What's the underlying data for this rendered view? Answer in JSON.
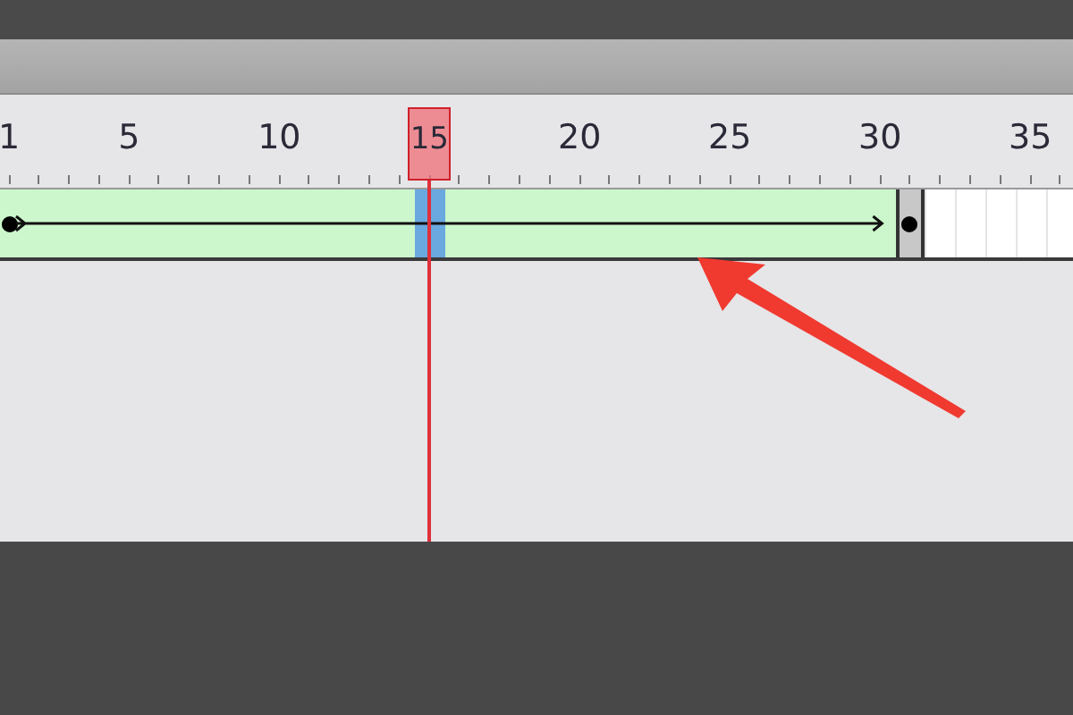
{
  "frames": [
    {
      "kind": "keyframe",
      "selected": false,
      "label": "1"
    },
    {
      "kind": "tween",
      "selected": false
    },
    {
      "kind": "tween",
      "selected": false
    },
    {
      "kind": "tween",
      "selected": false
    },
    {
      "kind": "tween",
      "selected": false,
      "label": "5"
    },
    {
      "kind": "tween",
      "selected": false
    },
    {
      "kind": "tween",
      "selected": false
    },
    {
      "kind": "tween",
      "selected": false
    },
    {
      "kind": "tween",
      "selected": false
    },
    {
      "kind": "tween",
      "selected": false,
      "label": "10"
    },
    {
      "kind": "tween",
      "selected": false
    },
    {
      "kind": "tween",
      "selected": false
    },
    {
      "kind": "tween",
      "selected": false
    },
    {
      "kind": "tween",
      "selected": false
    },
    {
      "kind": "tween",
      "selected": true,
      "label": "15"
    },
    {
      "kind": "tween",
      "selected": false
    },
    {
      "kind": "tween",
      "selected": false
    },
    {
      "kind": "tween",
      "selected": false
    },
    {
      "kind": "tween",
      "selected": false
    },
    {
      "kind": "tween",
      "selected": false,
      "label": "20"
    },
    {
      "kind": "tween",
      "selected": false
    },
    {
      "kind": "tween",
      "selected": false
    },
    {
      "kind": "tween",
      "selected": false
    },
    {
      "kind": "tween",
      "selected": false
    },
    {
      "kind": "tween",
      "selected": false,
      "label": "25"
    },
    {
      "kind": "tween",
      "selected": false
    },
    {
      "kind": "tween",
      "selected": false
    },
    {
      "kind": "tween",
      "selected": false
    },
    {
      "kind": "tween",
      "selected": false
    },
    {
      "kind": "tween",
      "selected": false,
      "label": "30"
    },
    {
      "kind": "endkey",
      "selected": false
    },
    {
      "kind": "empty",
      "selected": false
    },
    {
      "kind": "empty",
      "selected": false
    },
    {
      "kind": "empty",
      "selected": false
    },
    {
      "kind": "empty",
      "selected": false,
      "label": "35"
    },
    {
      "kind": "empty",
      "selected": false
    }
  ]
}
